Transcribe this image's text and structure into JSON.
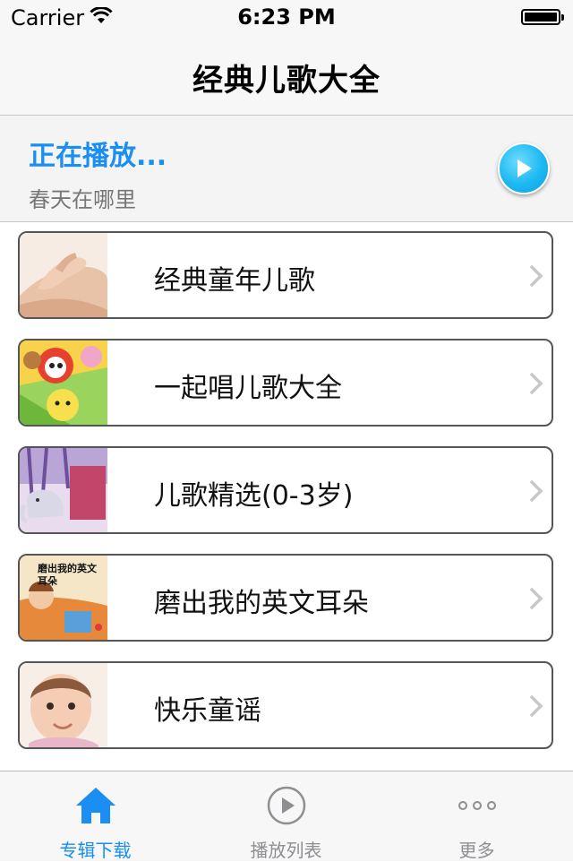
{
  "status_bar": {
    "carrier": "Carrier",
    "time": "6:23 PM"
  },
  "nav": {
    "title": "经典儿歌大全"
  },
  "now_playing": {
    "label": "正在播放...",
    "song": "春天在哪里"
  },
  "albums": [
    {
      "title": "经典童年儿歌",
      "thumb": "hands-photo"
    },
    {
      "title": "一起唱儿歌大全",
      "thumb": "cartoon-animals"
    },
    {
      "title": "儿歌精选(0-3岁)",
      "thumb": "elephant-illustration"
    },
    {
      "title": "磨出我的英文耳朵",
      "thumb": "book-cover",
      "thumb_text": "磨出我的英文耳朵"
    },
    {
      "title": "快乐童谣",
      "thumb": "baby-photo"
    }
  ],
  "tabs": [
    {
      "label": "专辑下载",
      "icon": "home-icon",
      "active": true
    },
    {
      "label": "播放列表",
      "icon": "play-circle-icon",
      "active": false
    },
    {
      "label": "更多",
      "icon": "more-dots-icon",
      "active": false
    }
  ],
  "colors": {
    "accent": "#1a8ef2",
    "play_button": "#1cb8f2",
    "bar_bg": "#f7f7f7"
  }
}
